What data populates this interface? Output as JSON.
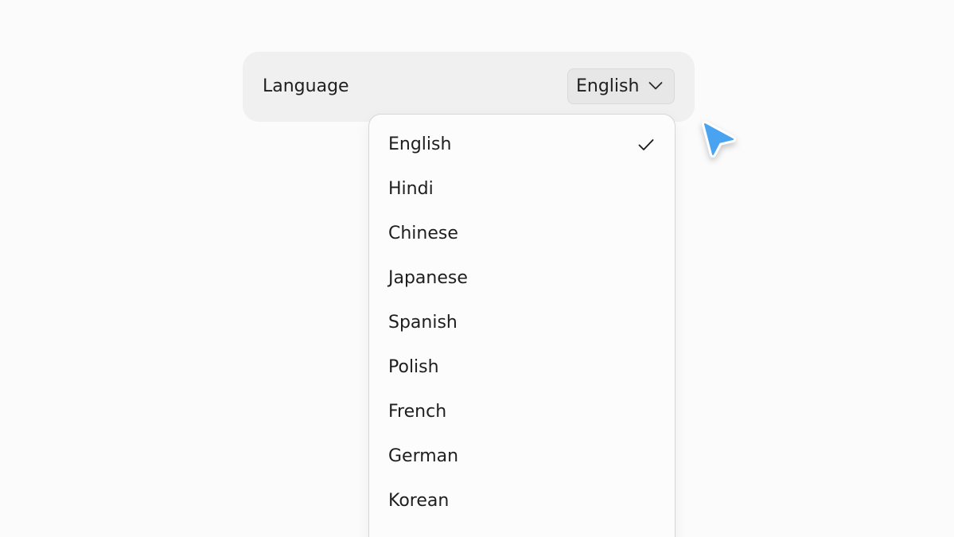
{
  "setting": {
    "label": "Language"
  },
  "select": {
    "value": "English",
    "icon": "chevron-down-icon"
  },
  "dropdown": {
    "options": [
      {
        "label": "English",
        "selected": true
      },
      {
        "label": "Hindi",
        "selected": false
      },
      {
        "label": "Chinese",
        "selected": false
      },
      {
        "label": "Japanese",
        "selected": false
      },
      {
        "label": "Spanish",
        "selected": false
      },
      {
        "label": "Polish",
        "selected": false
      },
      {
        "label": "French",
        "selected": false
      },
      {
        "label": "German",
        "selected": false
      },
      {
        "label": "Korean",
        "selected": false
      }
    ],
    "selected_icon": "checkmark-icon"
  },
  "cursor": {
    "icon": "pointer-cursor-icon",
    "color": "#4aa3f0"
  },
  "colors": {
    "background": "#fbfbfb",
    "row_background": "#f0f0f0",
    "select_background": "#e7e7e7",
    "dropdown_background": "#fcfcfc",
    "text": "#1e1e1e",
    "cursor_accent": "#4aa3f0"
  }
}
